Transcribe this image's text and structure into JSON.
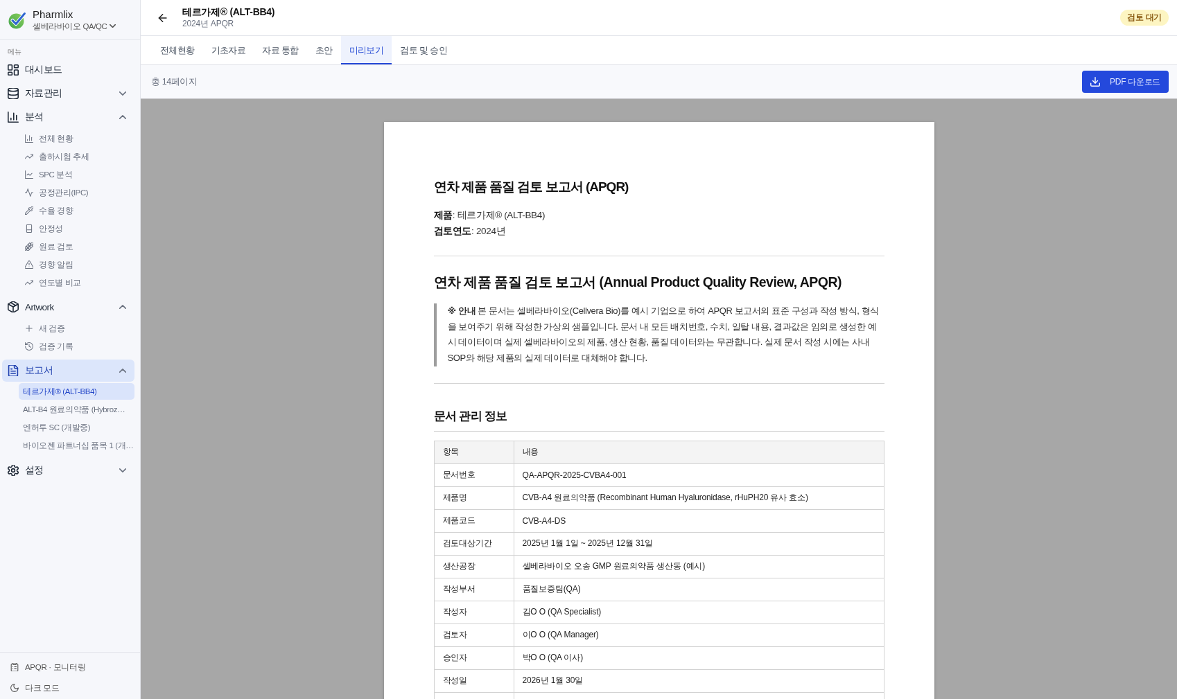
{
  "sidebar": {
    "brand": {
      "name": "Pharmlix",
      "workspace": "셀베라바이오 QA/QC"
    },
    "menu_label": "메뉴",
    "items": [
      {
        "kind": "link",
        "label": "대시보드",
        "selected": false
      },
      {
        "kind": "group",
        "label": "자료관리",
        "selected": false,
        "expanded": false
      },
      {
        "kind": "group",
        "label": "분석",
        "selected": false,
        "expanded": true,
        "children": [
          {
            "label": "전체 현황",
            "selected": false
          },
          {
            "label": "출하시험 추세",
            "selected": false
          },
          {
            "label": "SPC 분석",
            "selected": false
          },
          {
            "label": "공정관리(IPC)",
            "selected": false
          },
          {
            "label": "수율 경향",
            "selected": false
          },
          {
            "label": "안정성",
            "selected": false
          },
          {
            "label": "원료 검토",
            "selected": false
          },
          {
            "label": "경향 알림",
            "selected": false
          },
          {
            "label": "연도별 비교",
            "selected": false
          }
        ]
      },
      {
        "kind": "group",
        "label": "Artwork",
        "selected": false,
        "expanded": true,
        "children": [
          {
            "label": "새 검증",
            "selected": false
          },
          {
            "label": "검증 기록",
            "selected": false
          }
        ]
      },
      {
        "kind": "group",
        "label": "보고서",
        "selected": true,
        "expanded": true,
        "children": [
          {
            "label": "테르가제® (ALT-BB4)",
            "selected": true
          },
          {
            "label": "ALT-B4 원료의약품 (Hybroz…",
            "selected": false
          },
          {
            "label": "엔허투 SC (개발중)",
            "selected": false
          },
          {
            "label": "바이오젠 파트너십 품목 1 (개…",
            "selected": false
          }
        ]
      },
      {
        "kind": "group",
        "label": "설정",
        "selected": false,
        "expanded": false
      }
    ],
    "footer": [
      {
        "label": "APQR · 모니터링"
      },
      {
        "label": "다크 모드"
      }
    ]
  },
  "header": {
    "title": "테르가제® (ALT-BB4)",
    "subtitle": "2024년 APQR",
    "status": "검토 대기"
  },
  "tabs": [
    {
      "label": "전체현황",
      "selected": false
    },
    {
      "label": "기초자료",
      "selected": false
    },
    {
      "label": "자료 통합",
      "selected": false
    },
    {
      "label": "초안",
      "selected": false
    },
    {
      "label": "미리보기",
      "selected": true
    },
    {
      "label": "검토 및 승인",
      "selected": false
    }
  ],
  "toolbar": {
    "page_count": "총 14페이지",
    "download_button": "PDF 다운로드"
  },
  "document": {
    "title": "연차 제품 품질 검토 보고서 (APQR)",
    "meta": [
      "**제품**: 테르가제® (ALT-BB4)",
      "**검토연도**: 2024년"
    ],
    "heading": "연차 제품 품질 검토 보고서 (Annual Product Quality Review, APQR)",
    "notice": "**※ 안내** 본 문서는 셀베라바이오(Cellvera Bio)를 예시 기업으로 하여 APQR 보고서의 표준 구성과 작성 방식, 형식을 보여주기 위해 작성한 가상의 샘플입니다. 문서 내 모든 배치번호, 수치, 일탈 내용, 결과값은 임의로 생성한 예시 데이터이며 실제 셀베라바이오의 제품, 생산 현황, 품질 데이터와는 무관합니다. 실제 문서 작성 시에는 사내 SOP와 해당 제품의 실제 데이터로 대체해야 합니다.",
    "section_title": "문서 관리 정보",
    "table": {
      "columns": [
        "항목",
        "내용"
      ],
      "rows": [
        [
          "문서번호",
          "QA-APQR-2025-CVBA4-001"
        ],
        [
          "제품명",
          "CVB-A4 원료의약품 (Recombinant Human Hyaluronidase, rHuPH20 유사 효소)"
        ],
        [
          "제품코드",
          "CVB-A4-DS"
        ],
        [
          "검토대상기간",
          "2025년 1월 1일 ~ 2025년 12월 31일"
        ],
        [
          "생산공장",
          "셀베라바이오 오송 GMP 원료의약품 생산동 (예시)"
        ],
        [
          "작성부서",
          "품질보증팀(QA)"
        ],
        [
          "작성자",
          "김O O (QA Specialist)"
        ],
        [
          "검토자",
          "이O O (QA Manager)"
        ],
        [
          "승인자",
          "박O O (QA 이사)"
        ],
        [
          "작성일",
          "2026년 1월 30일"
        ]
      ]
    }
  }
}
